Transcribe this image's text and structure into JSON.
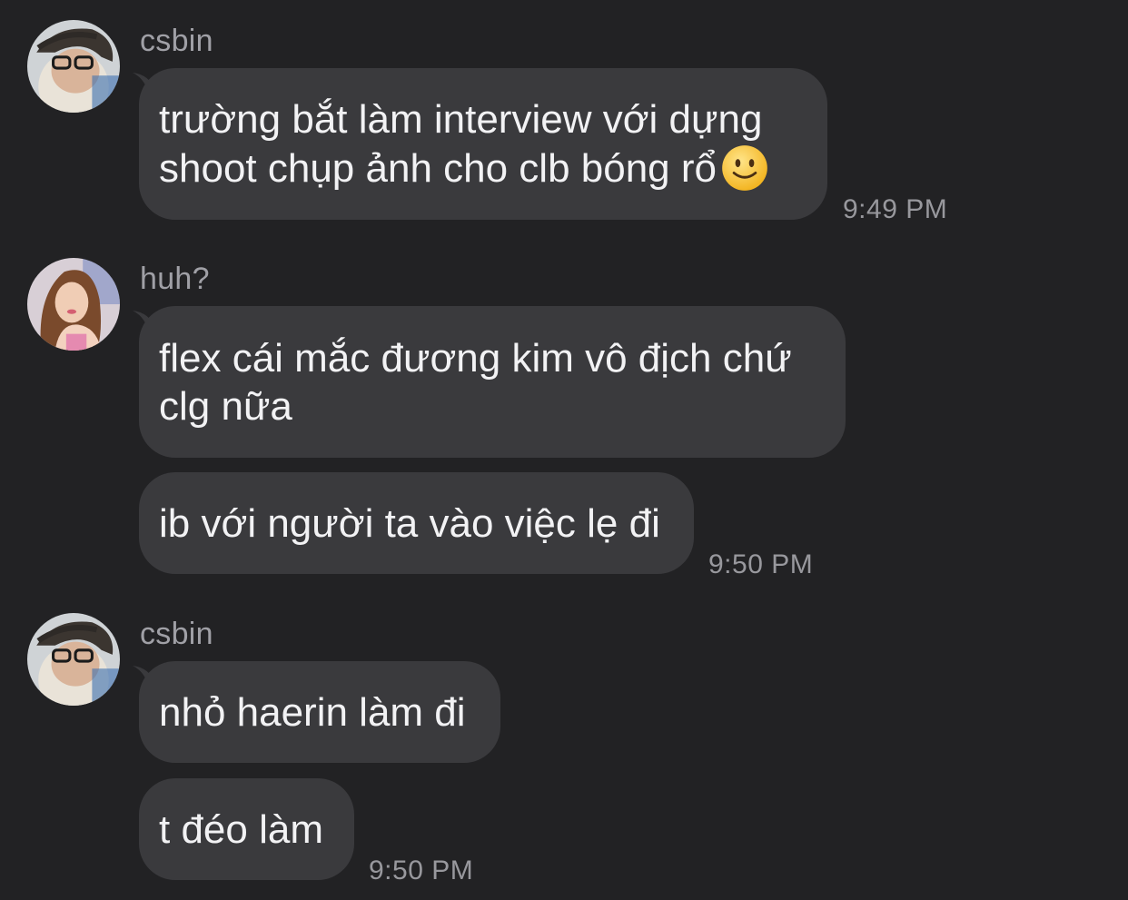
{
  "messages": [
    {
      "sender": "csbin",
      "avatar": "avatar-csbin",
      "bubbles": [
        {
          "text": "trường bắt làm interview với dựng\nshoot chụp ảnh cho clb bóng rổ",
          "emoji": "slightly-smiling-face-icon"
        }
      ],
      "time": "9:49 PM"
    },
    {
      "sender": "huh?",
      "avatar": "avatar-huh",
      "bubbles": [
        {
          "text": "flex cái mắc đương kim vô địch chứ\nclg nữa"
        },
        {
          "text": "ib với người ta vào việc lẹ đi"
        }
      ],
      "time": "9:50 PM"
    },
    {
      "sender": "csbin",
      "avatar": "avatar-csbin",
      "bubbles": [
        {
          "text": "nhỏ haerin làm đi"
        },
        {
          "text": "t đéo làm"
        }
      ],
      "time": "9:50 PM"
    }
  ],
  "colors": {
    "background": "#222224",
    "bubble": "#3a3a3d",
    "text": "#f2f2f4",
    "meta": "#a0a0a6"
  }
}
